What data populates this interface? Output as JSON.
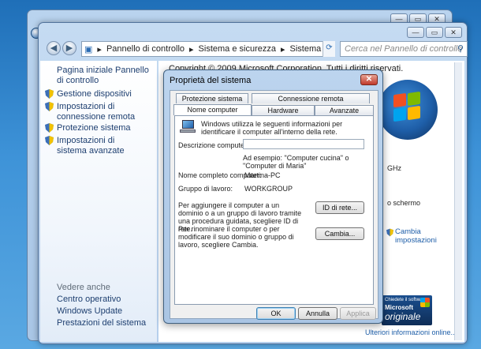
{
  "back_window": {
    "min": "—",
    "max": "▭",
    "close": "✕"
  },
  "main_window": {
    "min": "—",
    "max": "▭",
    "close": "✕",
    "address": {
      "part1": "Pannello di controllo",
      "part2": "Sistema e sicurezza",
      "part3": "Sistema",
      "sep": "▸"
    },
    "search_placeholder": "Cerca nel Pannello di controllo"
  },
  "sidebar": {
    "home": "Pagina iniziale Pannello di controllo",
    "items": [
      {
        "label": "Gestione dispositivi"
      },
      {
        "label": "Impostazioni di connessione remota"
      },
      {
        "label": "Protezione sistema"
      },
      {
        "label": "Impostazioni di sistema avanzate"
      }
    ],
    "see_also_title": "Vedere anche",
    "see_also": [
      "Centro operativo",
      "Windows Update",
      "Prestazioni del sistema"
    ]
  },
  "content": {
    "copyright": "Copyright © 2009 Microsoft Corporation. Tutti i diritti riservati.",
    "ghz": "GHz",
    "touch": "o schermo",
    "change_settings": "Cambia impostazioni",
    "more_info": "Ulteriori informazioni online...",
    "genuine_line1": "Chiedete il software",
    "genuine_line2": "Microsoft",
    "genuine_line3": "originale"
  },
  "dialog": {
    "title": "Proprietà del sistema",
    "close": "✕",
    "tabs_top": [
      "Protezione sistema",
      "Connessione remota"
    ],
    "tabs_bottom": [
      "Nome computer",
      "Hardware",
      "Avanzate"
    ],
    "intro": "Windows utilizza le seguenti informazioni per identificare il computer all'interno della rete.",
    "desc_label": "Descrizione computer:",
    "desc_value": "",
    "example": "Ad esempio: \"Computer cucina\" o \"Computer di Maria\"",
    "fullname_label": "Nome completo computer:",
    "fullname_value": "Martina-PC",
    "workgroup_label": "Gruppo di lavoro:",
    "workgroup_value": "WORKGROUP",
    "join_text": "Per aggiungere il computer a un dominio o a un gruppo di lavoro tramite una procedura guidata, scegliere ID di rete.",
    "netid_button": "ID di rete...",
    "rename_text": "Per rinominare il computer o per modificare il suo dominio o gruppo di lavoro, scegliere Cambia.",
    "change_button": "Cambia...",
    "ok": "OK",
    "cancel": "Annulla",
    "apply": "Applica"
  }
}
